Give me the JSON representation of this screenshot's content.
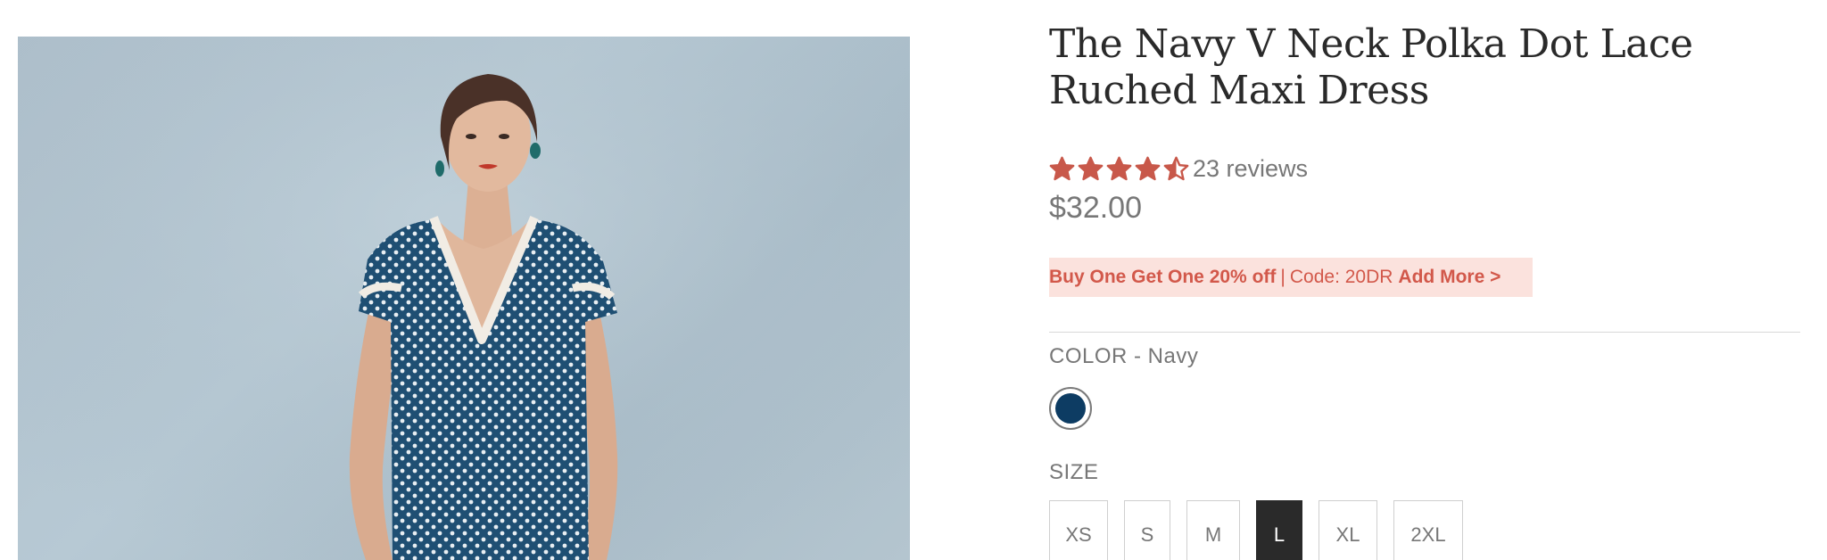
{
  "product": {
    "title": "The Navy V Neck Polka Dot Lace Ruched Maxi Dress",
    "rating_value": 4.5,
    "rating_max": 5,
    "reviews_text": "23 reviews",
    "price": "$32.00",
    "image_icon": "product-photo"
  },
  "promo": {
    "offer": "Buy One Get One 20% off",
    "separator": "|",
    "code_text": "Code: 20DR",
    "link": "Add More >"
  },
  "color": {
    "label": "COLOR - Navy",
    "swatches": [
      {
        "name": "Navy",
        "hex": "#0d3c63",
        "selected": true
      }
    ]
  },
  "size": {
    "label": "SIZE",
    "options": [
      {
        "label": "XS",
        "selected": false
      },
      {
        "label": "S",
        "selected": false
      },
      {
        "label": "M",
        "selected": false
      },
      {
        "label": "L",
        "selected": true
      },
      {
        "label": "XL",
        "selected": false
      },
      {
        "label": "2XL",
        "selected": false
      }
    ]
  },
  "colors": {
    "accent": "#c8584a",
    "promo_bg": "#fbe2dd",
    "selected_size_bg": "#2a2a2a",
    "swatch_navy": "#0d3c63",
    "photo_bg": "#b3c4cf",
    "dress": "#1f4f73"
  }
}
